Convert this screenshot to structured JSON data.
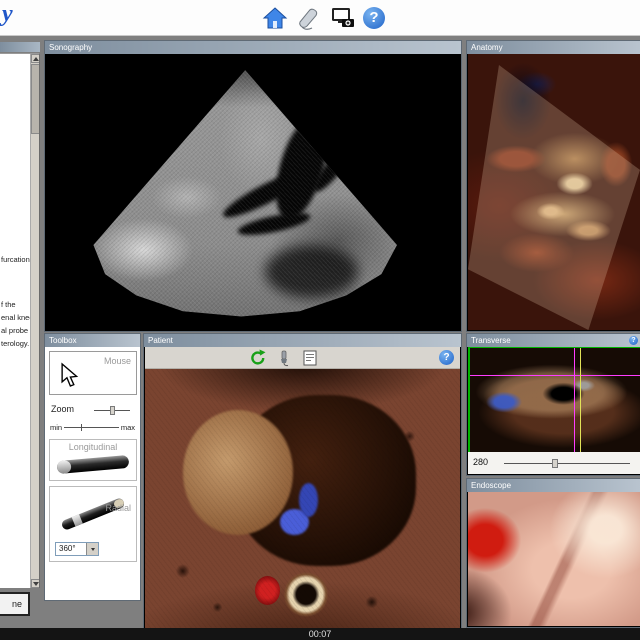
{
  "header": {
    "logo_fragment": "y",
    "help_glyph": "?"
  },
  "task": {
    "lines": [
      "furcation",
      "f the",
      "enal knee",
      "al probe",
      "terology."
    ],
    "button_fragment": "ne"
  },
  "panels": {
    "sonography": {
      "title": "Sonography"
    },
    "anatomy": {
      "title": "Anatomy"
    },
    "toolbox": {
      "title": "Toolbox",
      "mouse_label": "Mouse",
      "zoom_label": "Zoom",
      "zoom_min": "min",
      "zoom_max": "max",
      "longitudinal_label": "Longitudinal",
      "radial_label": "Radial",
      "angle_value": "360°"
    },
    "patient": {
      "title": "Patient",
      "help_glyph": "?"
    },
    "transverse": {
      "title": "Transverse",
      "depth_value": "280",
      "help_glyph": "?"
    },
    "endoscope": {
      "title": "Endoscope"
    }
  },
  "status": {
    "timer": "00:07"
  },
  "colors": {
    "accent_blue": "#2f6fd0",
    "crosshair_magenta": "#ff3cff",
    "crosshair_yellow": "#e2e258",
    "frame_green": "#00b400",
    "refresh_green": "#18a018"
  }
}
